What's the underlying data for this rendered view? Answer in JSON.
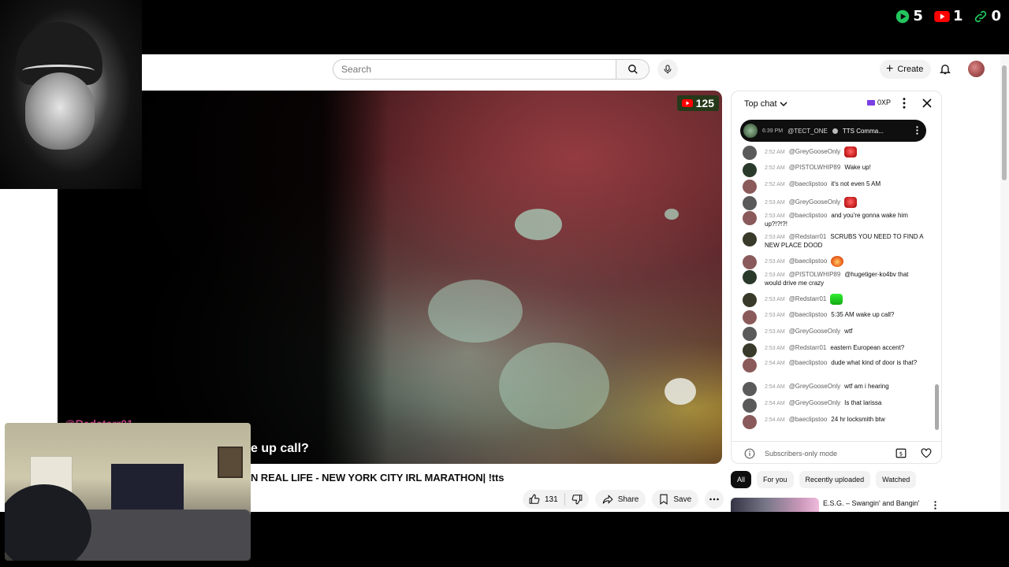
{
  "overlay": {
    "counters": [
      {
        "icon": "play-icon",
        "value": "5",
        "color": "#22c55e"
      },
      {
        "icon": "youtube-icon",
        "value": "1",
        "color": "#ff0000"
      },
      {
        "icon": "link-icon",
        "value": "0",
        "color": "#22c55e"
      }
    ],
    "chat_user_overlay": "@Redstarr01"
  },
  "header": {
    "search_placeholder": "Search",
    "create_label": "Create"
  },
  "video": {
    "viewer_count": "125",
    "caption": "e up call?",
    "title": "N REAL LIFE - NEW YORK CITY IRL MARATHON| !tts"
  },
  "actions": {
    "like_count": "131",
    "share_label": "Share",
    "save_label": "Save"
  },
  "chat": {
    "mode_label": "Top chat",
    "xp_label": "0XP",
    "pinned": {
      "time": "6:39 PM",
      "author": "@TECT_ONE",
      "text": "TTS Comma..."
    },
    "messages": [
      {
        "time": "2:52 AM",
        "author": "@GreyGooseOnly",
        "text": "",
        "emote": "red",
        "avatar_color": "#5a5a5a"
      },
      {
        "time": "2:52 AM",
        "author": "@PISTOLWHIP89",
        "text": "Wake up!",
        "emote": "",
        "avatar_color": "#2a3a2a"
      },
      {
        "time": "2:52 AM",
        "author": "@baeclipstoo",
        "text": "it's not even 5 AM",
        "emote": "",
        "avatar_color": "#8a5a5a"
      },
      {
        "time": "2:53 AM",
        "author": "@GreyGooseOnly",
        "text": "",
        "emote": "red",
        "avatar_color": "#5a5a5a"
      },
      {
        "time": "2:53 AM",
        "author": "@baeclipstoo",
        "text": "and you're gonna wake him up?!?!?!",
        "emote": "",
        "avatar_color": "#8a5a5a"
      },
      {
        "time": "2:53 AM",
        "author": "@Redstarr01",
        "text": "SCRUBS YOU NEED TO FIND A NEW PLACE DOOD",
        "emote": "",
        "avatar_color": "#3a3a2a"
      },
      {
        "time": "2:53 AM",
        "author": "@baeclipstoo",
        "text": "",
        "emote": "fire",
        "avatar_color": "#8a5a5a"
      },
      {
        "time": "2:53 AM",
        "author": "@PISTOLWHIP89",
        "text": "@hugetiger-ko4bv that would drive me crazy",
        "emote": "",
        "avatar_color": "#2a3a2a"
      },
      {
        "time": "2:53 AM",
        "author": "@Redstarr01",
        "text": "",
        "emote": "green",
        "avatar_color": "#3a3a2a"
      },
      {
        "time": "2:53 AM",
        "author": "@baeclipstoo",
        "text": "5:35 AM wake up call?",
        "emote": "",
        "avatar_color": "#8a5a5a"
      },
      {
        "time": "2:53 AM",
        "author": "@GreyGooseOnly",
        "text": "wtf",
        "emote": "",
        "avatar_color": "#5a5a5a"
      },
      {
        "time": "2:53 AM",
        "author": "@Redstarr01",
        "text": "eastern European accent?",
        "emote": "",
        "avatar_color": "#3a3a2a"
      },
      {
        "time": "2:54 AM",
        "author": "@baeclipstoo",
        "text": "dude what kind of door is that?",
        "emote": "",
        "avatar_color": "#8a5a5a"
      },
      {
        "time": "2:54 AM",
        "author": "@GreyGooseOnly",
        "text": "wtf am i hearing",
        "emote": "",
        "avatar_color": "#5a5a5a"
      },
      {
        "time": "2:54 AM",
        "author": "@GreyGooseOnly",
        "text": "Is that larissa",
        "emote": "",
        "avatar_color": "#5a5a5a"
      },
      {
        "time": "2:54 AM",
        "author": "@baeclipstoo",
        "text": "24 hr locksmith btw",
        "emote": "",
        "avatar_color": "#8a5a5a"
      }
    ],
    "footer_text": "Subscribers-only mode"
  },
  "chips": [
    "All",
    "For you",
    "Recently uploaded",
    "Watched"
  ],
  "recommendation": {
    "title": "E.S.G. – Swangin' and Bangin'"
  }
}
